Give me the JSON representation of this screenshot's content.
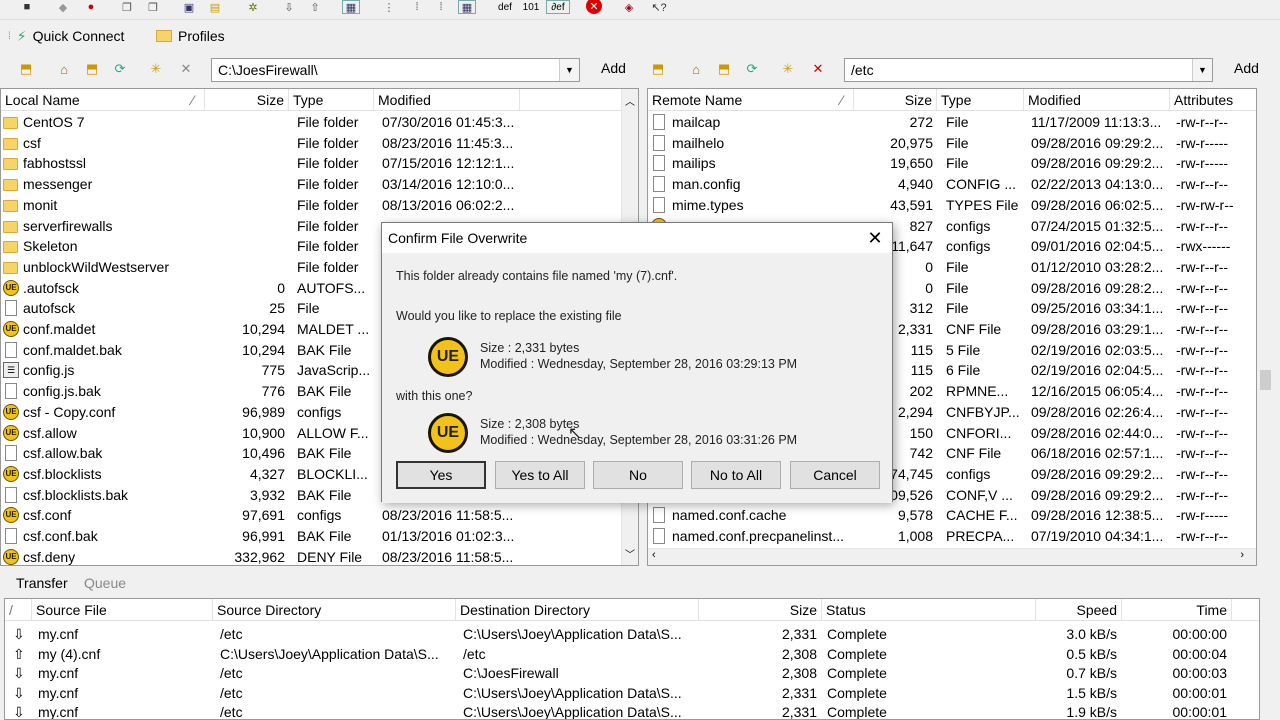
{
  "toolbar": {
    "icons": [
      "save-icon",
      "disconnect-icon",
      "stop-icon",
      "copy-icon",
      "paste-icon",
      "connect-icon",
      "folder-icon",
      "settings-icon",
      "download-icon",
      "upload-icon",
      "view-icon",
      "sort-icon",
      "list-icon",
      "details-icon",
      "def-icon",
      "binary-icon",
      "auto-icon",
      "cancel-icon",
      "book-icon",
      "help-icon"
    ],
    "binary_label": "101",
    "def_label": "def"
  },
  "quick_connect": {
    "label": "Quick Connect",
    "profiles_label": "Profiles"
  },
  "local": {
    "path": "C:\\JoesFirewall\\",
    "add_label": "Add",
    "columns": [
      "Local Name",
      "Size",
      "Type",
      "Modified"
    ],
    "rows": [
      {
        "name": "CentOS 7",
        "size": "",
        "type": "File folder",
        "modified": "07/30/2016 01:45:3...",
        "icon": "folder"
      },
      {
        "name": "csf",
        "size": "",
        "type": "File folder",
        "modified": "08/23/2016 11:45:3...",
        "icon": "folder"
      },
      {
        "name": "fabhostssl",
        "size": "",
        "type": "File folder",
        "modified": "07/15/2016 12:12:1...",
        "icon": "folder"
      },
      {
        "name": "messenger",
        "size": "",
        "type": "File folder",
        "modified": "03/14/2016 12:10:0...",
        "icon": "folder"
      },
      {
        "name": "monit",
        "size": "",
        "type": "File folder",
        "modified": "08/13/2016 06:02:2...",
        "icon": "folder"
      },
      {
        "name": "serverfirewalls",
        "size": "",
        "type": "File folder",
        "modified": "",
        "icon": "folder"
      },
      {
        "name": "Skeleton",
        "size": "",
        "type": "File folder",
        "modified": "",
        "icon": "folder"
      },
      {
        "name": "unblockWildWestserver",
        "size": "",
        "type": "File folder",
        "modified": "",
        "icon": "folder"
      },
      {
        "name": ".autofsck",
        "size": "0",
        "type": "AUTOFS...",
        "modified": "",
        "icon": "ue"
      },
      {
        "name": "autofsck",
        "size": "25",
        "type": "File",
        "modified": "",
        "icon": "doc"
      },
      {
        "name": "conf.maldet",
        "size": "10,294",
        "type": "MALDET ...",
        "modified": "",
        "icon": "ue"
      },
      {
        "name": "conf.maldet.bak",
        "size": "10,294",
        "type": "BAK File",
        "modified": "",
        "icon": "doc"
      },
      {
        "name": "config.js",
        "size": "775",
        "type": "JavaScrip...",
        "modified": "",
        "icon": "js"
      },
      {
        "name": "config.js.bak",
        "size": "776",
        "type": "BAK File",
        "modified": "",
        "icon": "doc"
      },
      {
        "name": "csf - Copy.conf",
        "size": "96,989",
        "type": "configs",
        "modified": "",
        "icon": "ue"
      },
      {
        "name": "csf.allow",
        "size": "10,900",
        "type": "ALLOW F...",
        "modified": "",
        "icon": "ue"
      },
      {
        "name": "csf.allow.bak",
        "size": "10,496",
        "type": "BAK File",
        "modified": "",
        "icon": "doc"
      },
      {
        "name": "csf.blocklists",
        "size": "4,327",
        "type": "BLOCKLI...",
        "modified": "",
        "icon": "ue"
      },
      {
        "name": "csf.blocklists.bak",
        "size": "3,932",
        "type": "BAK File",
        "modified": "",
        "icon": "doc"
      },
      {
        "name": "csf.conf",
        "size": "97,691",
        "type": "configs",
        "modified": "08/23/2016 11:58:5...",
        "icon": "ue"
      },
      {
        "name": "csf.conf.bak",
        "size": "96,991",
        "type": "BAK File",
        "modified": "01/13/2016 01:02:3...",
        "icon": "doc"
      },
      {
        "name": "csf.deny",
        "size": "332,962",
        "type": "DENY File",
        "modified": "08/23/2016 11:58:5...",
        "icon": "ue"
      }
    ]
  },
  "remote": {
    "path": "/etc",
    "add_label": "Add",
    "columns": [
      "Remote Name",
      "Size",
      "Type",
      "Modified",
      "Attributes"
    ],
    "rows": [
      {
        "name": "mailcap",
        "size": "272",
        "type": "File",
        "modified": "11/17/2009 11:13:3...",
        "attr": "-rw-r--r--",
        "icon": "doc"
      },
      {
        "name": "mailhelo",
        "size": "20,975",
        "type": "File",
        "modified": "09/28/2016 09:29:2...",
        "attr": "-rw-r-----",
        "icon": "doc"
      },
      {
        "name": "mailips",
        "size": "19,650",
        "type": "File",
        "modified": "09/28/2016 09:29:2...",
        "attr": "-rw-r-----",
        "icon": "doc"
      },
      {
        "name": "man.config",
        "size": "4,940",
        "type": "CONFIG ...",
        "modified": "02/22/2013 04:13:0...",
        "attr": "-rw-r--r--",
        "icon": "doc"
      },
      {
        "name": "mime.types",
        "size": "43,591",
        "type": "TYPES File",
        "modified": "09/28/2016 06:02:5...",
        "attr": "-rw-rw-r--",
        "icon": "doc"
      },
      {
        "name": "",
        "size": "827",
        "type": "configs",
        "modified": "07/24/2015 01:32:5...",
        "attr": "-rw-r--r--",
        "icon": "ue"
      },
      {
        "name": "",
        "size": "11,647",
        "type": "configs",
        "modified": "09/01/2016 02:04:5...",
        "attr": "-rwx------",
        "icon": ""
      },
      {
        "name": "",
        "size": "0",
        "type": "File",
        "modified": "01/12/2010 03:28:2...",
        "attr": "-rw-r--r--",
        "icon": ""
      },
      {
        "name": "",
        "size": "0",
        "type": "File",
        "modified": "09/28/2016 09:28:2...",
        "attr": "-rw-r--r--",
        "icon": ""
      },
      {
        "name": "",
        "size": "312",
        "type": "File",
        "modified": "09/25/2016 03:34:1...",
        "attr": "-rw-r--r--",
        "icon": ""
      },
      {
        "name": "",
        "size": "2,331",
        "type": "CNF File",
        "modified": "09/28/2016 03:29:1...",
        "attr": "-rw-r--r--",
        "icon": ""
      },
      {
        "name": "",
        "size": "115",
        "type": "5 File",
        "modified": "02/19/2016 02:03:5...",
        "attr": "-rw-r--r--",
        "icon": ""
      },
      {
        "name": "",
        "size": "115",
        "type": "6 File",
        "modified": "02/19/2016 02:04:5...",
        "attr": "-rw-r--r--",
        "icon": ""
      },
      {
        "name": "",
        "size": "202",
        "type": "RPMNE...",
        "modified": "12/16/2015 06:05:4...",
        "attr": "-rw-r--r--",
        "icon": ""
      },
      {
        "name": "",
        "size": "2,294",
        "type": "CNFBYJP...",
        "modified": "09/28/2016 02:26:4...",
        "attr": "-rw-r--r--",
        "icon": ""
      },
      {
        "name": "",
        "size": "150",
        "type": "CNFORI...",
        "modified": "09/28/2016 02:44:0...",
        "attr": "-rw-r--r--",
        "icon": ""
      },
      {
        "name": "",
        "size": "742",
        "type": "CNF File",
        "modified": "06/18/2016 02:57:1...",
        "attr": "-rw-r--r--",
        "icon": ""
      },
      {
        "name": "",
        "size": "74,745",
        "type": "configs",
        "modified": "09/28/2016 09:29:2...",
        "attr": "-rw-r--r--",
        "icon": ""
      },
      {
        "name": "",
        "size": "09,526",
        "type": "CONF,V ...",
        "modified": "09/28/2016 09:29:2...",
        "attr": "-rw-r--r--",
        "icon": ""
      },
      {
        "name": "named.conf.cache",
        "size": "9,578",
        "type": "CACHE F...",
        "modified": "09/28/2016 12:38:5...",
        "attr": "-rw-r-----",
        "icon": "doc"
      },
      {
        "name": "named.conf.precpanelinst...",
        "size": "1,008",
        "type": "PRECPA...",
        "modified": "07/19/2010 04:34:1...",
        "attr": "-rw-r--r--",
        "icon": "doc"
      }
    ]
  },
  "tabs": {
    "transfer": "Transfer",
    "queue": "Queue"
  },
  "transfer": {
    "columns": [
      "/",
      "Source File",
      "Source Directory",
      "Destination Directory",
      "Size",
      "Status",
      "Speed",
      "Time"
    ],
    "rows": [
      {
        "dir": "⇩",
        "file": "my.cnf",
        "src": "/etc",
        "dst": "C:\\Users\\Joey\\Application Data\\S...",
        "size": "2,331",
        "status": "Complete",
        "speed": "3.0 kB/s",
        "time": "00:00:00"
      },
      {
        "dir": "⇧",
        "file": "my (4).cnf",
        "src": "C:\\Users\\Joey\\Application Data\\S...",
        "dst": "/etc",
        "size": "2,308",
        "status": "Complete",
        "speed": "0.5 kB/s",
        "time": "00:00:04"
      },
      {
        "dir": "⇩",
        "file": "my.cnf",
        "src": "/etc",
        "dst": "C:\\JoesFirewall",
        "size": "2,308",
        "status": "Complete",
        "speed": "0.7 kB/s",
        "time": "00:00:03"
      },
      {
        "dir": "⇩",
        "file": "my.cnf",
        "src": "/etc",
        "dst": "C:\\Users\\Joey\\Application Data\\S...",
        "size": "2,331",
        "status": "Complete",
        "speed": "1.5 kB/s",
        "time": "00:00:01"
      },
      {
        "dir": "⇩",
        "file": "my.cnf",
        "src": "/etc",
        "dst": "C:\\Users\\Joey\\Application Data\\S...",
        "size": "2,331",
        "status": "Complete",
        "speed": "1.9 kB/s",
        "time": "00:00:01"
      }
    ]
  },
  "dialog": {
    "title": "Confirm File Overwrite",
    "message": "This folder already contains file named 'my (7).cnf'.",
    "question": "Would you like to replace the existing file",
    "existing": {
      "size": "Size : 2,331 bytes",
      "modified": "Modified : Wednesday, September 28, 2016 03:29:13 PM"
    },
    "with_label": "with this one?",
    "incoming": {
      "size": "Size : 2,308 bytes",
      "modified": "Modified : Wednesday, September 28, 2016 03:31:26 PM"
    },
    "ue_label": "UE",
    "close_glyph": "✕",
    "buttons": {
      "yes": "Yes",
      "yes_all": "Yes to All",
      "no": "No",
      "no_all": "No to All",
      "cancel": "Cancel"
    }
  }
}
